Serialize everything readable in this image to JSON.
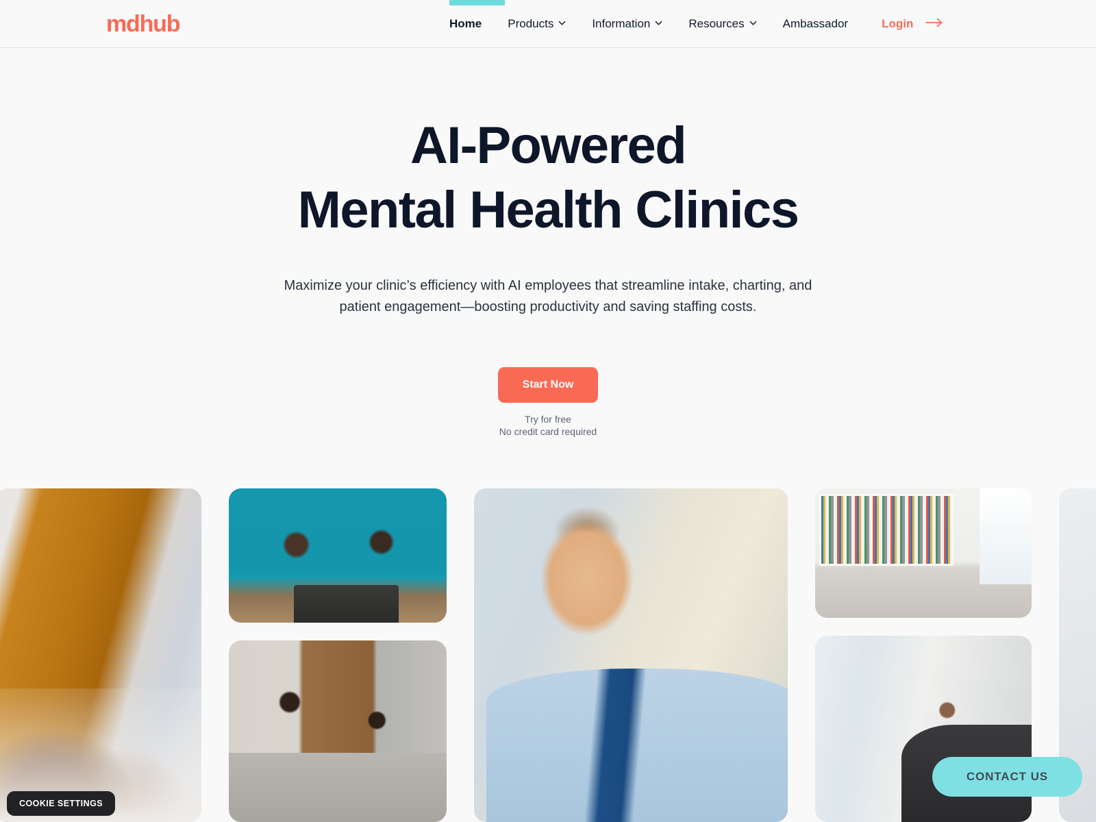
{
  "brand": {
    "logo_text": "mdhub",
    "accent_coral": "#F96A55",
    "accent_teal": "#6EDBDF",
    "ink": "#0E1629",
    "page_bg": "#F9F9FA"
  },
  "header": {
    "nav": [
      {
        "label": "Home",
        "has_dropdown": false,
        "active": true
      },
      {
        "label": "Products",
        "has_dropdown": true,
        "active": false
      },
      {
        "label": "Information",
        "has_dropdown": true,
        "active": false
      },
      {
        "label": "Resources",
        "has_dropdown": true,
        "active": false
      },
      {
        "label": "Ambassador",
        "has_dropdown": false,
        "active": false
      }
    ],
    "login_label": "Login",
    "login_icon": "arrow-right-icon",
    "chevron_icon": "chevron-down-icon"
  },
  "hero": {
    "title_line1": "AI-Powered",
    "title_line2": "Mental Health Clinics",
    "subtitle": "Maximize your clinic’s efficiency with AI employees that streamline intake, charting, and patient engagement—boosting productivity and saving staffing costs.",
    "cta_label": "Start Now",
    "note_line1": "Try for free",
    "note_line2": "No credit card required"
  },
  "gallery": {
    "photos": [
      {
        "alt": "therapist holding patient hands, mustard sweater"
      },
      {
        "alt": "two colleagues smiling at desk with laptop, teal wall"
      },
      {
        "alt": "therapist and client talking on couch, wood wall"
      },
      {
        "alt": "smiling man in light blue shirt and navy tie at office window"
      },
      {
        "alt": "two people seated in bright room with bookshelves"
      },
      {
        "alt": "man working at desk with laptop by window"
      },
      {
        "alt": "bright office interior"
      }
    ]
  },
  "floating": {
    "cookie_label": "COOKIE SETTINGS",
    "contact_label": "CONTACT US"
  }
}
